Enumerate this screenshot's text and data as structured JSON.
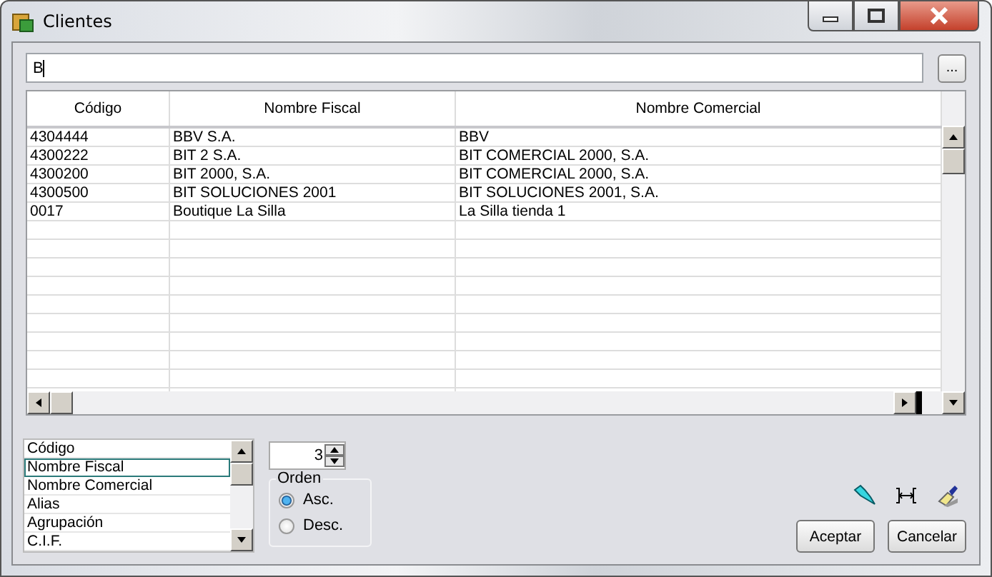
{
  "window": {
    "title": "Clientes"
  },
  "search": {
    "value": "B",
    "browse_button": "..."
  },
  "table": {
    "columns": [
      "Código",
      "Nombre Fiscal",
      "Nombre Comercial"
    ],
    "rows": [
      [
        "4304444",
        "BBV S.A.",
        "BBV"
      ],
      [
        "4300222",
        "BIT 2 S.A.",
        "BIT COMERCIAL 2000, S.A."
      ],
      [
        "4300200",
        "BIT 2000, S.A.",
        "BIT COMERCIAL 2000, S.A."
      ],
      [
        "4300500",
        "BIT SOLUCIONES 2001",
        "BIT SOLUCIONES 2001, S.A."
      ],
      [
        "0017",
        "Boutique La Silla",
        "La Silla tienda 1"
      ]
    ]
  },
  "fields_list": [
    {
      "label": "Código",
      "selected": false
    },
    {
      "label": "Nombre Fiscal",
      "selected": true
    },
    {
      "label": "Nombre Comercial",
      "selected": false
    },
    {
      "label": "Alias",
      "selected": false
    },
    {
      "label": "Agrupación",
      "selected": false
    },
    {
      "label": "C.I.F.",
      "selected": false
    }
  ],
  "spinner": {
    "value": "3"
  },
  "order": {
    "title": "Orden",
    "options": [
      {
        "label": "Asc.",
        "selected": true
      },
      {
        "label": "Desc.",
        "selected": false
      }
    ]
  },
  "buttons": [
    "Aceptar",
    "Cancelar"
  ]
}
